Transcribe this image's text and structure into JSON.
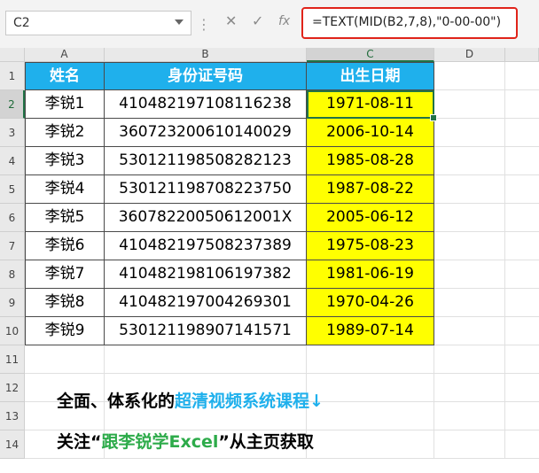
{
  "formula_bar": {
    "name_box": "C2",
    "cancel_icon": "✕",
    "enter_icon": "✓",
    "fx_icon": "fx",
    "formula": "=TEXT(MID(B2,7,8),\"0-00-00\")"
  },
  "columns": [
    "A",
    "B",
    "C",
    "D"
  ],
  "rows": [
    "1",
    "2",
    "3",
    "4",
    "5",
    "6",
    "7",
    "8",
    "9",
    "10",
    "11",
    "12",
    "13",
    "14"
  ],
  "table": {
    "headers": [
      "姓名",
      "身份证号码",
      "出生日期"
    ],
    "records": [
      {
        "name": "李锐1",
        "id": "410482197108116238",
        "birth": "1971-08-11"
      },
      {
        "name": "李锐2",
        "id": "360723200610140029",
        "birth": "2006-10-14"
      },
      {
        "name": "李锐3",
        "id": "530121198508282123",
        "birth": "1985-08-28"
      },
      {
        "name": "李锐4",
        "id": "530121198708223750",
        "birth": "1987-08-22"
      },
      {
        "name": "李锐5",
        "id": "36078220050612001X",
        "birth": "2005-06-12"
      },
      {
        "name": "李锐6",
        "id": "410482197508237389",
        "birth": "1975-08-23"
      },
      {
        "name": "李锐7",
        "id": "410482198106197382",
        "birth": "1981-06-19"
      },
      {
        "name": "李锐8",
        "id": "410482197004269301",
        "birth": "1970-04-26"
      },
      {
        "name": "李锐9",
        "id": "530121198907141571",
        "birth": "1989-07-14"
      }
    ]
  },
  "promo": {
    "line1_prefix": "全面、体系化的",
    "line1_highlight": "超清视频系统课程↓",
    "line2_prefix": "关注“",
    "line2_highlight": "跟李锐学Excel",
    "line2_suffix": "”从主页获取"
  },
  "colors": {
    "header_fill": "#1fb0ec",
    "date_fill": "#ffff00",
    "formula_border": "#e0241a",
    "selection": "#217346",
    "promo_blue": "#1fb0ec",
    "promo_green": "#2dab4a"
  }
}
